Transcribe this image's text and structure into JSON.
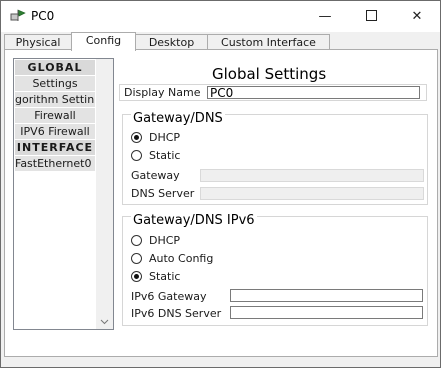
{
  "window": {
    "title": "PC0",
    "minimize_glyph": "—",
    "close_glyph": "✕"
  },
  "tabs": [
    {
      "label": "Physical",
      "active": false
    },
    {
      "label": "Config",
      "active": true
    },
    {
      "label": "Desktop",
      "active": false
    },
    {
      "label": "Custom Interface",
      "active": false
    }
  ],
  "sidebar": {
    "items": [
      {
        "label": "GLOBAL",
        "type": "header"
      },
      {
        "label": "Settings",
        "type": "item"
      },
      {
        "label": "gorithm Settin",
        "type": "item"
      },
      {
        "label": "Firewall",
        "type": "item"
      },
      {
        "label": "IPV6 Firewall",
        "type": "item"
      },
      {
        "label": "INTERFACE",
        "type": "header"
      },
      {
        "label": "FastEthernet0",
        "type": "item"
      }
    ]
  },
  "main": {
    "title": "Global Settings",
    "display_name_label": "Display Name",
    "display_name_value": "PC0"
  },
  "gateway_dns": {
    "title": "Gateway/DNS",
    "dhcp_label": "DHCP",
    "static_label": "Static",
    "selected": "DHCP",
    "gateway_label": "Gateway",
    "gateway_value": "",
    "dns_label": "DNS Server",
    "dns_value": ""
  },
  "gateway_dns_ipv6": {
    "title": "Gateway/DNS IPv6",
    "dhcp_label": "DHCP",
    "auto_label": "Auto Config",
    "static_label": "Static",
    "selected": "Static",
    "gateway_label": "IPv6 Gateway",
    "gateway_value": "",
    "dns_label": "IPv6 DNS Server",
    "dns_value": ""
  },
  "colors": {
    "window_bg": "#f0f0f0",
    "panel_bg": "#ffffff",
    "list_item_bg": "#e3e3e3",
    "icon_accent": "#2e7d32"
  }
}
